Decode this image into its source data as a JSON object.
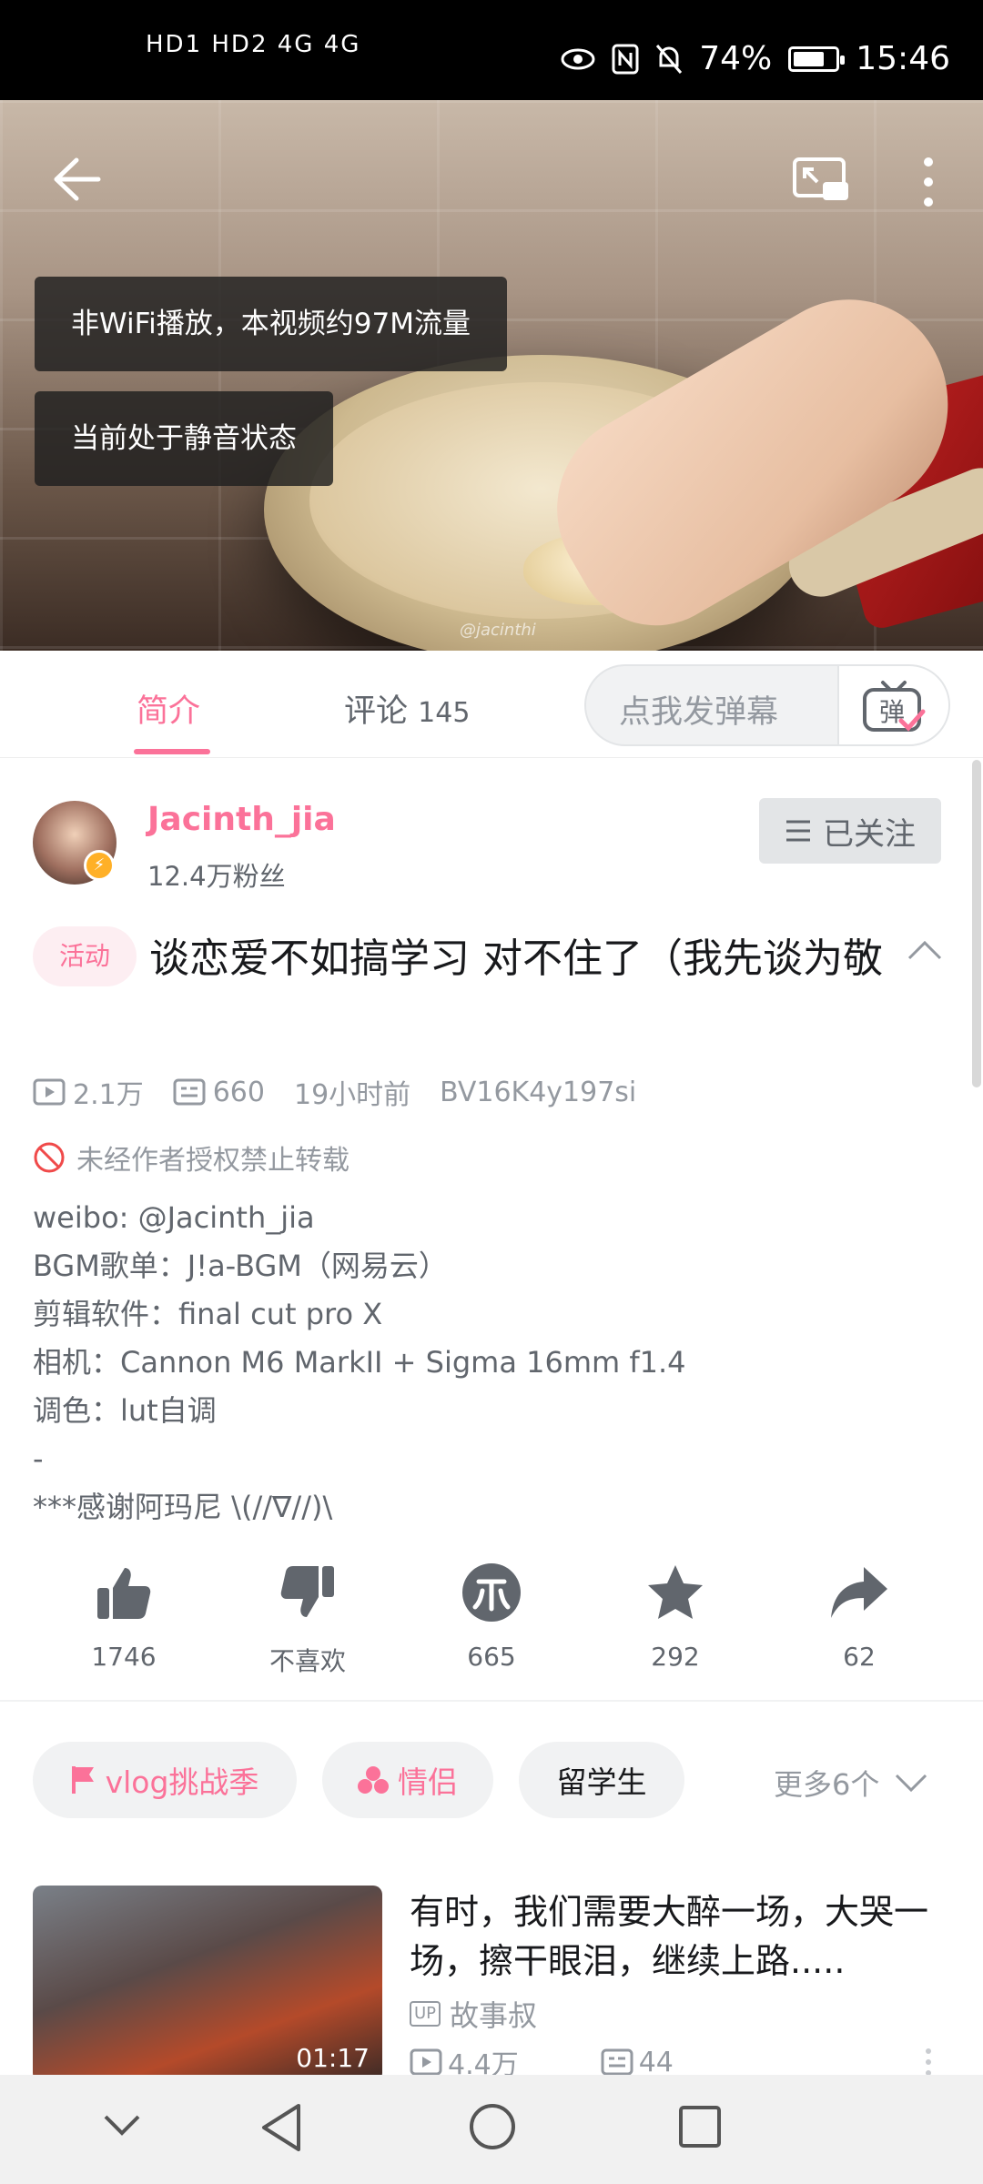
{
  "status_bar": {
    "left_indicators": "HD1 HD2 4G 4G",
    "battery_pct": "74%",
    "battery_level": 0.74,
    "time": "15:46"
  },
  "video": {
    "watermark": "@jacinthi",
    "toasts": [
      "非WiFi播放，本视频约97M流量",
      "当前处于静音状态"
    ]
  },
  "tabs": {
    "intro": "简介",
    "comments_label": "评论",
    "comments_count": "145",
    "danmaku_placeholder": "点我发弹幕",
    "danmaku_icon_text": "弹"
  },
  "uploader": {
    "name": "Jacinth_jia",
    "fans": "12.4万粉丝",
    "follow_state": "已关注"
  },
  "video_info": {
    "tag": "活动",
    "title": "谈恋爱不如搞学习 对不住了（我先谈为敬",
    "views": "2.1万",
    "danmaku_count": "660",
    "posted": "19小时前",
    "bvid": "BV16K4y197si",
    "copyright_notice": "未经作者授权禁止转载",
    "description": [
      "weibo: @Jacinth_jia",
      "BGM歌单：J!a-BGM（网易云）",
      "剪辑软件：final cut pro X",
      "相机：Cannon M6 MarkII + Sigma 16mm f1.4",
      "调色：lut自调",
      "-",
      "***感谢阿玛尼 \\(//∇//)\\"
    ]
  },
  "actions": {
    "like": "1746",
    "dislike": "不喜欢",
    "coin": "665",
    "favorite": "292",
    "share": "62"
  },
  "tags": {
    "chips": [
      "vlog挑战季",
      "情侣",
      "留学生"
    ],
    "more": "更多6个"
  },
  "recommended": {
    "duration": "01:17",
    "title": "有时，我们需要大醉一场，大哭一场，擦干眼泪，继续上路.....",
    "up_badge": "UP",
    "uploader": "故事叔",
    "views": "4.4万",
    "danmaku": "44"
  },
  "colors": {
    "accent": "#fb7299",
    "text": "#18191c",
    "secondary": "#61666d",
    "muted": "#9499a0"
  }
}
